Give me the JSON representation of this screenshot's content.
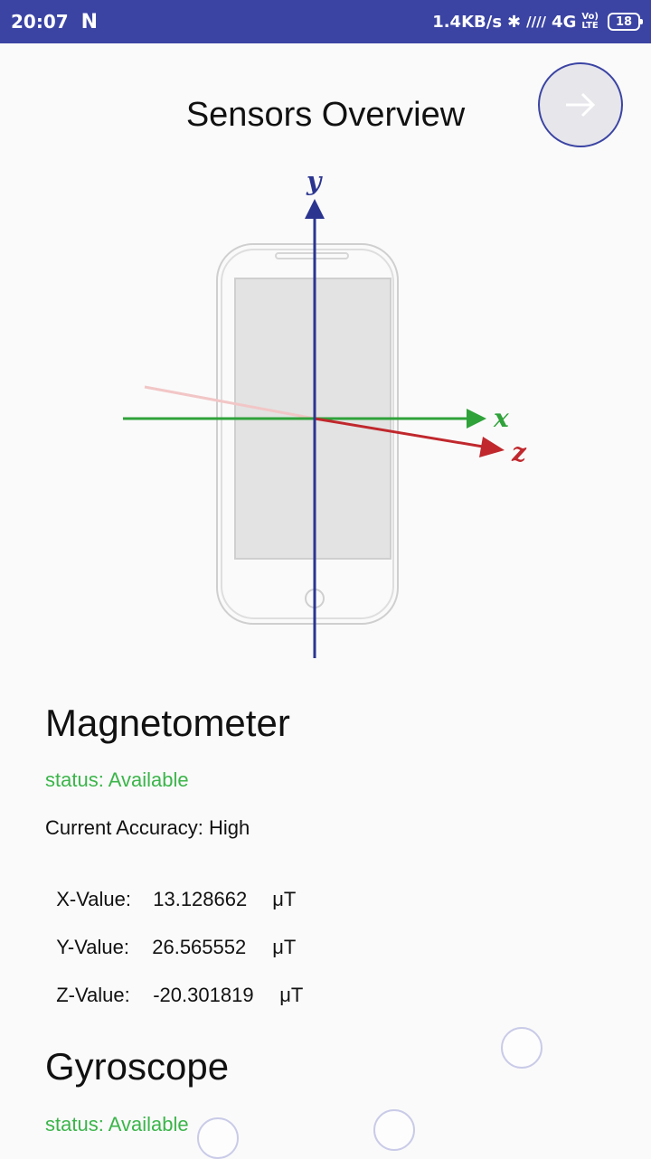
{
  "statusbar": {
    "time": "20:07",
    "net_speed": "1.4KB/s",
    "network": "4G",
    "volte_top": "Vo)",
    "volte_bottom": "LTE",
    "battery": "18"
  },
  "header": {
    "title": "Sensors Overview"
  },
  "diagram": {
    "y_label": "y",
    "x_label": "x",
    "z_label": "z"
  },
  "magnetometer": {
    "title": "Magnetometer",
    "status": "status: Available",
    "accuracy": "Current Accuracy: High",
    "x_label": "X-Value:",
    "x_value": "13.128662",
    "x_unit": "μT",
    "y_label": "Y-Value:",
    "y_value": "26.565552",
    "y_unit": "μT",
    "z_label": "Z-Value:",
    "z_value": "-20.301819",
    "z_unit": "μT"
  },
  "gyroscope": {
    "title": "Gyroscope",
    "status": "status: Available"
  },
  "colors": {
    "statusbar": "#3b44a3",
    "available": "#3bb54a"
  }
}
